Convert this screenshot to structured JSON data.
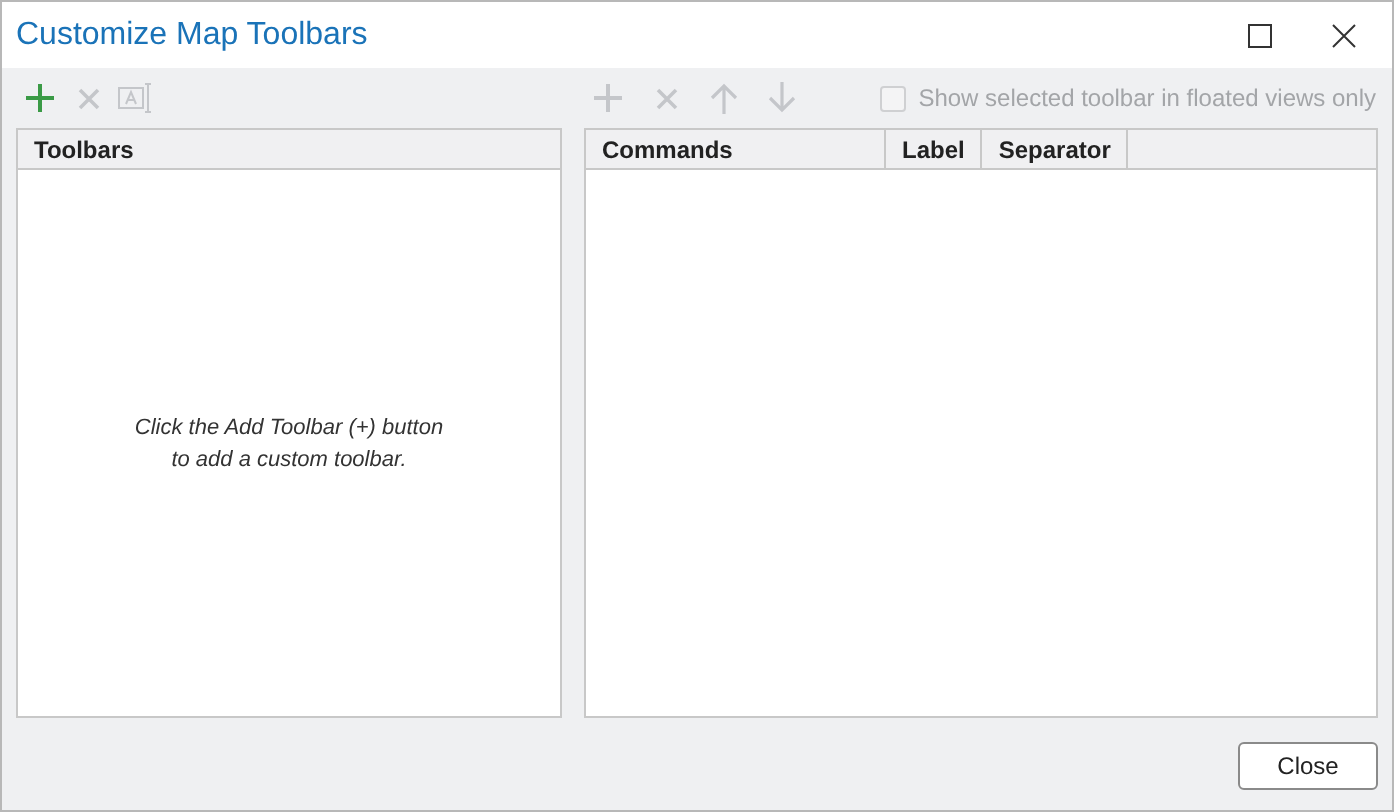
{
  "window": {
    "title": "Customize Map Toolbars"
  },
  "left_toolbar": [
    {
      "kind": "add",
      "disabled": false
    },
    {
      "kind": "delete",
      "disabled": true
    },
    {
      "kind": "rename",
      "disabled": true
    }
  ],
  "toolbars_panel": {
    "header": "Toolbars",
    "empty_message": "Click the Add Toolbar (+) button\nto add a custom toolbar."
  },
  "right_toolbar": [
    {
      "kind": "add",
      "disabled": true
    },
    {
      "kind": "delete",
      "disabled": true
    },
    {
      "kind": "up",
      "disabled": true
    },
    {
      "kind": "down",
      "disabled": true
    }
  ],
  "floated_option": {
    "label": "Show selected toolbar in floated views only",
    "checked": false,
    "disabled": true
  },
  "commands_table": {
    "columns": [
      "Commands",
      "Label",
      "Separator"
    ]
  },
  "buttons": [
    "Close"
  ]
}
